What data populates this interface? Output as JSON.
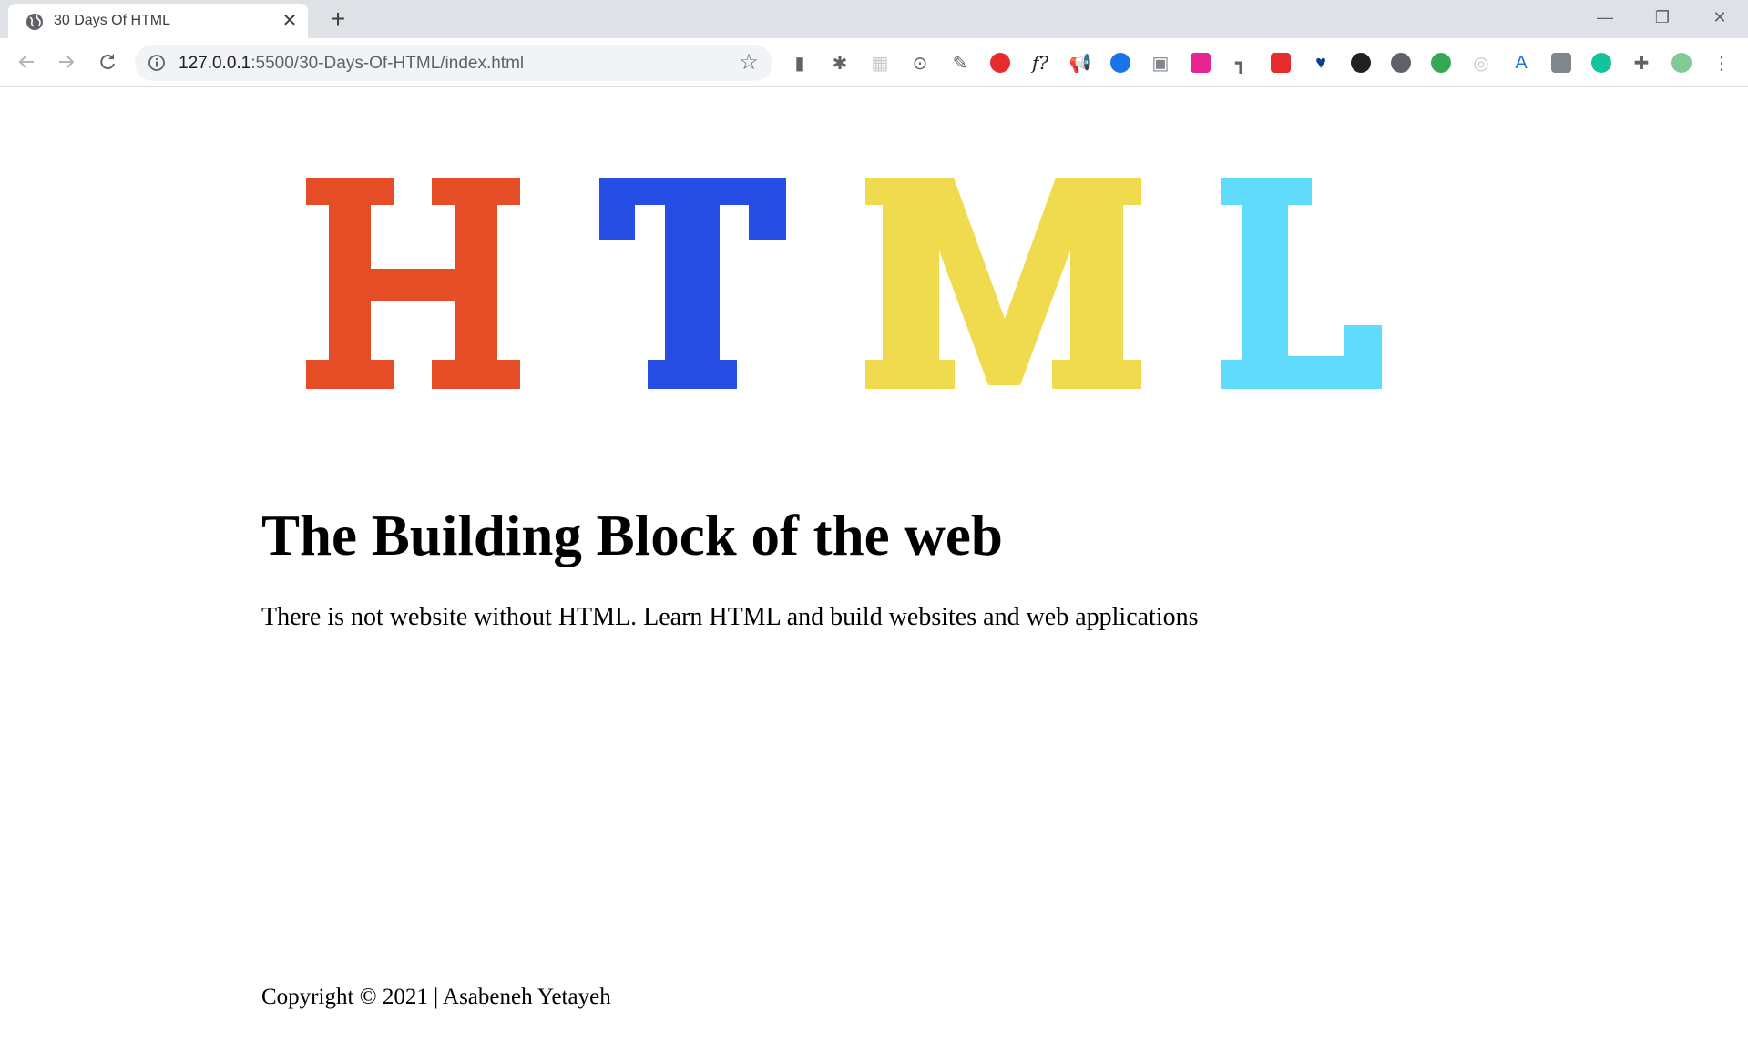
{
  "browser": {
    "tab_title": "30 Days Of HTML",
    "tab_close": "✕",
    "new_tab": "+",
    "url_host": "127.0.0.1",
    "url_path": ":5500/30-Days-Of-HTML/index.html",
    "window": {
      "minimize": "—",
      "restore": "❐",
      "close": "✕"
    },
    "extensions": [
      {
        "icon": "columns-icon",
        "color": "#5f6368"
      },
      {
        "icon": "bug-icon",
        "color": "#5f6368"
      },
      {
        "icon": "grid-icon",
        "color": "#c8c8c8"
      },
      {
        "icon": "code-brackets-icon",
        "color": "#5f6368"
      },
      {
        "icon": "eyedropper-icon",
        "color": "#5f6368"
      },
      {
        "icon": "shield-icon",
        "color": "#e52b2b"
      },
      {
        "icon": "font-question-icon",
        "color": "#202124"
      },
      {
        "icon": "megaphone-icon",
        "color": "#e8710a"
      },
      {
        "icon": "circle-swirl-icon",
        "color": "#1a73e8"
      },
      {
        "icon": "camera-icon",
        "color": "#80868b"
      },
      {
        "icon": "pink-square-icon",
        "color": "#e52592"
      },
      {
        "icon": "pipe-icon",
        "color": "#5f6368"
      },
      {
        "icon": "red-square-icon",
        "color": "#e52b2b"
      },
      {
        "icon": "heart-icon",
        "color": "#0b3d91"
      },
      {
        "icon": "g-circle-icon",
        "color": "#202124"
      },
      {
        "icon": "w-circle-icon",
        "color": "#5f6368"
      },
      {
        "icon": "colorwheel-icon",
        "color": "#34a853"
      },
      {
        "icon": "target-icon",
        "color": "#c8c8c8"
      },
      {
        "icon": "a-print-icon",
        "color": "#1a73e8"
      },
      {
        "icon": "grey-square-icon",
        "color": "#80868b"
      },
      {
        "icon": "grammarly-icon",
        "color": "#15c39a"
      },
      {
        "icon": "puzzle-icon",
        "color": "#5f6368"
      },
      {
        "icon": "profile-avatar-icon",
        "color": "#81c995"
      },
      {
        "icon": "menu-dots-icon",
        "color": "#5f6368"
      }
    ]
  },
  "logo": {
    "letters": [
      {
        "char": "H",
        "color": "#e44d26"
      },
      {
        "char": "T",
        "color": "#264de4"
      },
      {
        "char": "M",
        "color": "#f0db4f"
      },
      {
        "char": "L",
        "color": "#61dbfb"
      }
    ]
  },
  "page": {
    "title": "The Building Block of the web",
    "description": "There is not website without HTML. Learn HTML and build websites and web applications",
    "footer": "Copyright © 2021 | Asabeneh Yetayeh"
  }
}
